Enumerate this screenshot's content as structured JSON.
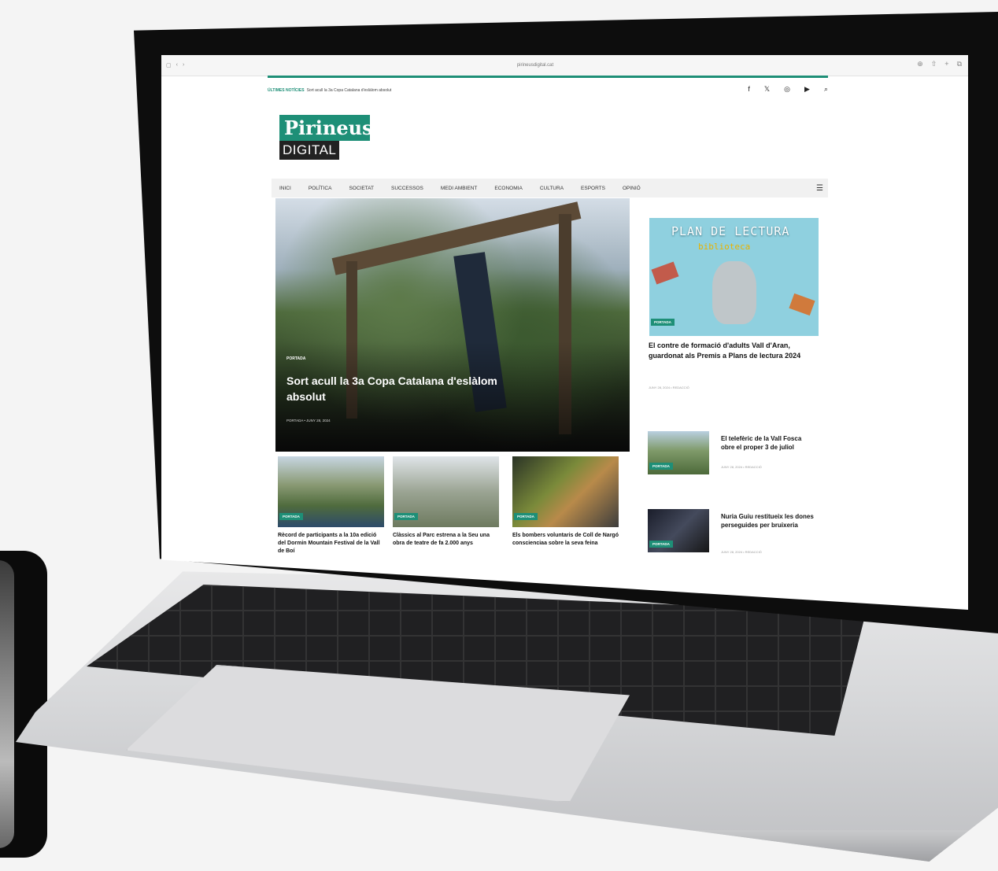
{
  "browser": {
    "url": "pirineusdigital.cat"
  },
  "ticker": {
    "label": "ÚLTIMES NOTÍCIES",
    "text": "Sort acull la 3a Copa Catalana d'eslàlom absolut"
  },
  "logo": {
    "top": "Pirineus",
    "bottom": "DIGITAL"
  },
  "nav": {
    "items": [
      "INICI",
      "POLÍTICA",
      "SOCIETAT",
      "SUCCESSOS",
      "MEDI AMBIENT",
      "ECONOMIA",
      "CULTURA",
      "ESPORTS",
      "OPINIÓ"
    ]
  },
  "hero": {
    "category": "PORTADA",
    "title": "Sort acull la 3a Copa Catalana d'eslàlom absolut",
    "meta": "PORTADA • JUNY 28, 2024"
  },
  "side_feature": {
    "headline": "PLAN DE LECTURA",
    "sub": "biblioteca",
    "tag": "PORTADA",
    "title": "El contre de formació d'adults Vall d'Aran, guardonat als Premis a Plans de lectura 2024",
    "meta": "JUNY 28, 2024 • REDACCIÓ"
  },
  "side_list": [
    {
      "tag": "PORTADA",
      "title": "El telefèric de la Vall Fosca obre el proper 3 de juliol",
      "meta": "JUNY 28, 2024 • REDACCIÓ"
    },
    {
      "tag": "PORTADA",
      "title": "Nuria Guiu restitueix les dones perseguides per bruixeria",
      "meta": "JUNY 28, 2024 • REDACCIÓ"
    }
  ],
  "cards": [
    {
      "tag": "PORTADA",
      "title": "Rècord de participants a la 10a edició del Dormin Mountain Festival de la Vall de Boí"
    },
    {
      "tag": "PORTADA",
      "title": "Clàssics al Parc estrena a la Seu una obra de teatre de fa 2.000 anys"
    },
    {
      "tag": "PORTADA",
      "title": "Els bombers voluntaris de Coll de Nargó conscienciaa sobre la seva feina"
    }
  ]
}
